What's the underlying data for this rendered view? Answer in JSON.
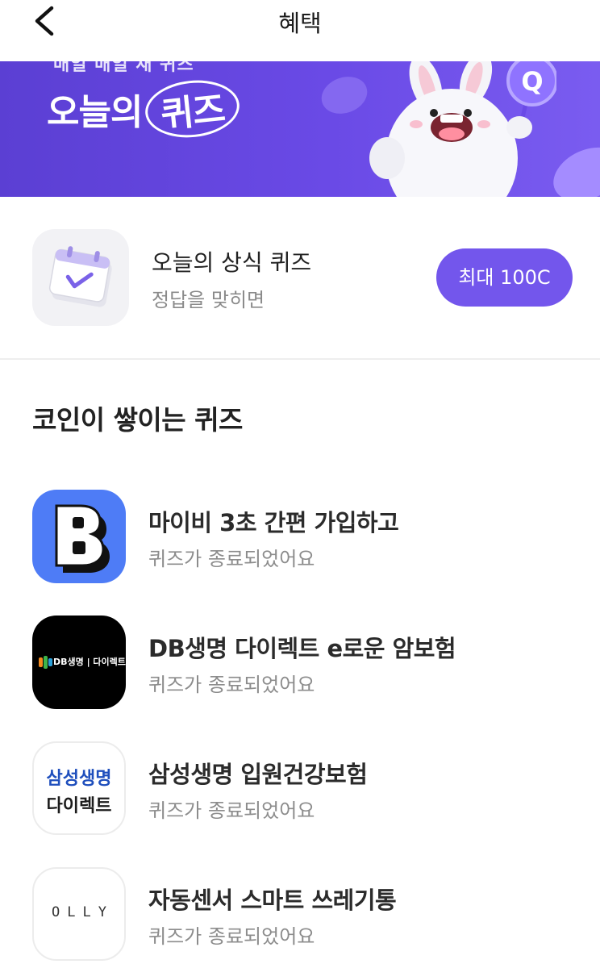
{
  "header": {
    "title": "혜택",
    "back_icon": "chevron-left-icon"
  },
  "banner": {
    "subtitle": "매일 매일 새 퀴즈",
    "title_main": "오늘의",
    "title_highlight": "퀴즈",
    "colors": {
      "background": "#6a4ae6",
      "accent": "#9b82ff"
    }
  },
  "today_quiz": {
    "icon": "calendar-check-icon",
    "title": "오늘의 상식 퀴즈",
    "subtitle": "정답을 맞히면",
    "reward_label": "최대 100C",
    "reward_color": "#7356ec"
  },
  "section": {
    "title": "코인이 쌓이는 퀴즈"
  },
  "quizzes": [
    {
      "logo": "mybee-b-logo",
      "title": "마이비 3초 간편 가입하고",
      "status": "퀴즈가 종료되었어요"
    },
    {
      "logo": "db-life-logo",
      "logo_text": "DB생명 | 다이렉트",
      "title": "DB생명 다이렉트 e로운 암보험",
      "status": "퀴즈가 종료되었어요"
    },
    {
      "logo": "samsung-life-logo",
      "logo_line1": "삼성생명",
      "logo_line2": "다이렉트",
      "title": "삼성생명 입원건강보험",
      "status": "퀴즈가 종료되었어요"
    },
    {
      "logo": "olly-logo",
      "logo_text": "OLLY",
      "title": "자동센서 스마트 쓰레기통",
      "status": "퀴즈가 종료되었어요"
    }
  ]
}
